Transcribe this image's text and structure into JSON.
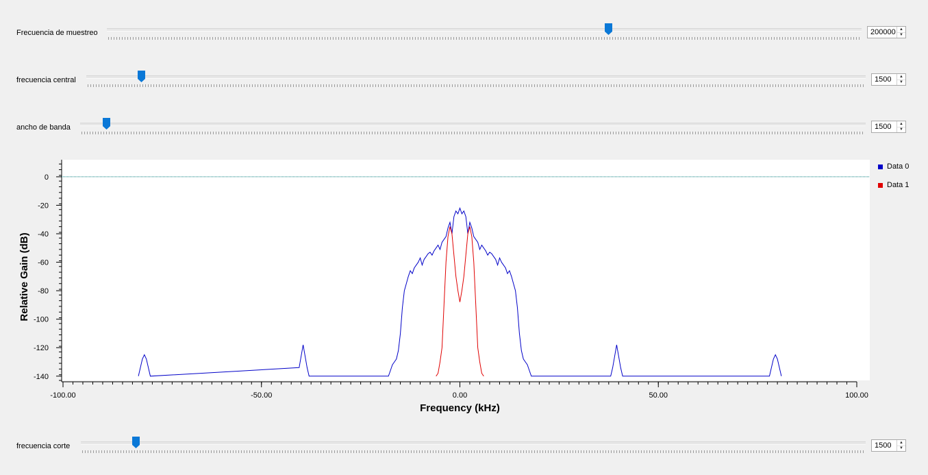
{
  "sliders": [
    {
      "label": "Frecuencia de muestreo",
      "value": "200000",
      "fraction": 0.635
    },
    {
      "label": "frecuencia central",
      "value": "1500",
      "fraction": 0.07
    },
    {
      "label": "ancho de banda",
      "value": "1500",
      "fraction": 0.034
    },
    {
      "label": "frecuencia corte",
      "value": "1500",
      "fraction": 0.07
    }
  ],
  "spin_arrows": {
    "up": "▲",
    "down": "▼"
  },
  "colors": {
    "handle": "#0a78d7",
    "series0": "#0000c8",
    "series1": "#e00000",
    "reference": "#007a7a"
  },
  "icons": {
    "slider_handle": "slider-handle-icon",
    "spin_up": "spin-up-icon",
    "spin_down": "spin-down-icon"
  },
  "chart_data": {
    "type": "line",
    "xlabel": "Frequency (kHz)",
    "ylabel": "Relative Gain (dB)",
    "xlim": [
      -100,
      100
    ],
    "ylim": [
      -143,
      12
    ],
    "x_ticks": [
      -100,
      -50,
      0,
      50,
      100
    ],
    "x_tick_labels": [
      "-100.00",
      "-50.00",
      "0.00",
      "50.00",
      "100.00"
    ],
    "y_ticks": [
      0,
      -20,
      -40,
      -60,
      -80,
      -100,
      -120,
      -140
    ],
    "y_tick_labels": [
      "0",
      "-20",
      "-40",
      "-60",
      "-80",
      "-100",
      "-120",
      "-140"
    ],
    "reference_line": {
      "y": 0,
      "style": "dotted"
    },
    "legend": "right",
    "series": [
      {
        "name": "Data 0",
        "color": "#0000c8",
        "x": [
          -81,
          -80.5,
          -80,
          -79.5,
          -79,
          -78.5,
          -78,
          -40.5,
          -40,
          -39.5,
          -39,
          -38.5,
          -38,
          -18,
          -17.5,
          -17,
          -16.5,
          -16,
          -15.5,
          -15,
          -14.5,
          -14,
          -13.5,
          -13,
          -12.5,
          -12,
          -11.5,
          -11,
          -10.5,
          -10,
          -9.5,
          -9,
          -8.5,
          -8,
          -7.5,
          -7,
          -6.5,
          -6,
          -5.5,
          -5,
          -4.5,
          -4,
          -3.5,
          -3,
          -2.5,
          -2,
          -1.5,
          -1,
          -0.5,
          0,
          0.5,
          1,
          1.5,
          2,
          2.5,
          3,
          3.5,
          4,
          4.5,
          5,
          5.5,
          6,
          6.5,
          7,
          7.5,
          8,
          8.5,
          9,
          9.5,
          10,
          10.5,
          11,
          11.5,
          12,
          12.5,
          13,
          13.5,
          14,
          14.5,
          15,
          15.5,
          16,
          16.5,
          17,
          17.5,
          18,
          38,
          38.5,
          39,
          39.5,
          40,
          40.5,
          41,
          78,
          78.5,
          79,
          79.5,
          80,
          80.5,
          81
        ],
        "y": [
          -140,
          -134,
          -128,
          -125,
          -128,
          -134,
          -140,
          -134,
          -126,
          -118,
          -126,
          -134,
          -140,
          -140,
          -136,
          -132,
          -130,
          -128,
          -122,
          -110,
          -92,
          -80,
          -75,
          -70,
          -66,
          -68,
          -64,
          -62,
          -60,
          -57,
          -62,
          -58,
          -56,
          -54,
          -53,
          -55,
          -52,
          -50,
          -48,
          -51,
          -46,
          -44,
          -42,
          -36,
          -32,
          -40,
          -28,
          -24,
          -26,
          -22,
          -26,
          -24,
          -28,
          -40,
          -32,
          -36,
          -42,
          -44,
          -46,
          -51,
          -48,
          -50,
          -52,
          -55,
          -53,
          -54,
          -56,
          -58,
          -62,
          -57,
          -60,
          -62,
          -64,
          -68,
          -66,
          -70,
          -75,
          -80,
          -92,
          -110,
          -122,
          -128,
          -130,
          -132,
          -136,
          -140,
          -140,
          -134,
          -126,
          -118,
          -126,
          -134,
          -140,
          -140,
          -134,
          -128,
          -125,
          -128,
          -134,
          -140
        ]
      },
      {
        "name": "Data 1",
        "color": "#e00000",
        "x": [
          -6,
          -5.5,
          -5,
          -4.5,
          -4,
          -3.5,
          -3,
          -2.5,
          -2,
          -1.5,
          -1,
          -0.5,
          0,
          0.5,
          1,
          1.5,
          2,
          2.5,
          3,
          3.5,
          4,
          4.5,
          5,
          5.5,
          6
        ],
        "y": [
          -140,
          -138,
          -130,
          -120,
          -90,
          -60,
          -42,
          -35,
          -40,
          -55,
          -70,
          -80,
          -88,
          -80,
          -70,
          -55,
          -40,
          -35,
          -42,
          -60,
          -90,
          -120,
          -130,
          -138,
          -140
        ]
      }
    ]
  }
}
